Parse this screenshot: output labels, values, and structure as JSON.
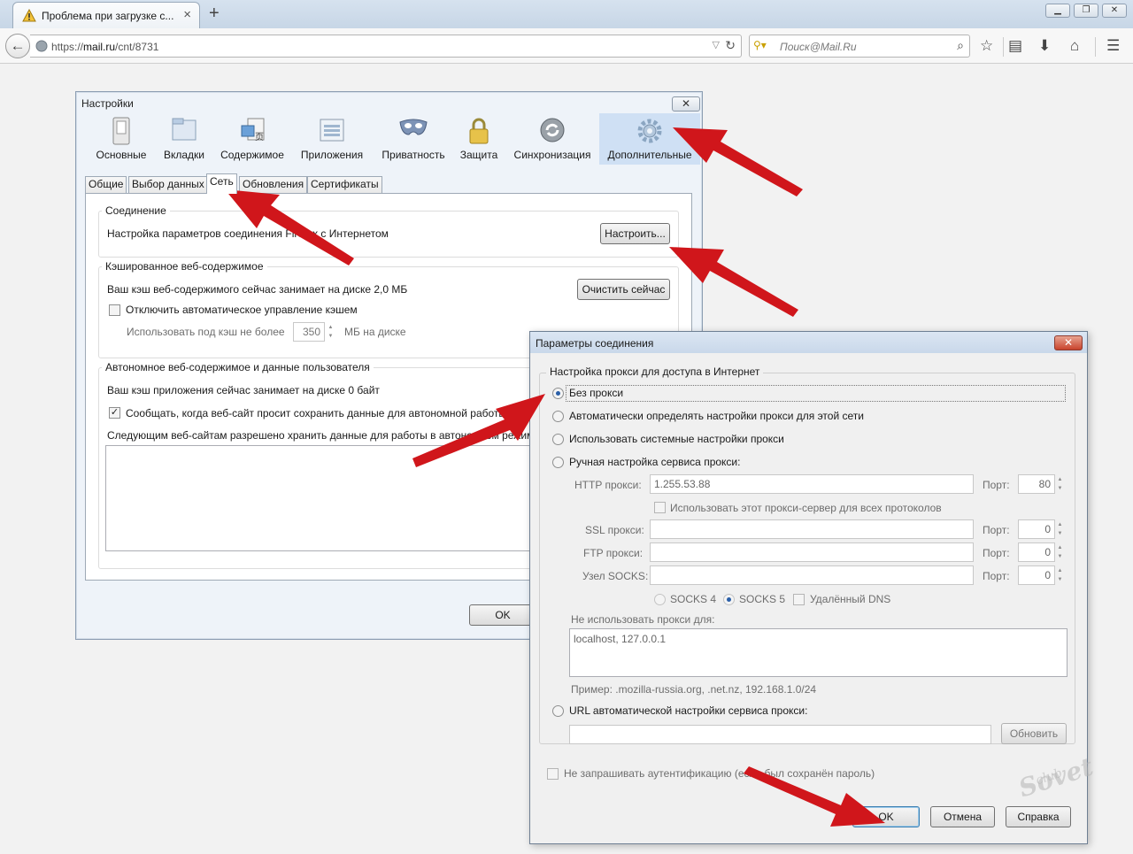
{
  "browser": {
    "tab_title": "Проблема при загрузке с...",
    "url_prefix": "https://",
    "url_host": "mail.ru",
    "url_path": "/cnt/8731",
    "search_placeholder": "Поиск@Mail.Ru"
  },
  "settings": {
    "title": "Настройки",
    "toolbar": [
      {
        "label": "Основные"
      },
      {
        "label": "Вкладки"
      },
      {
        "label": "Содержимое"
      },
      {
        "label": "Приложения"
      },
      {
        "label": "Приватность"
      },
      {
        "label": "Защита"
      },
      {
        "label": "Синхронизация"
      },
      {
        "label": "Дополнительные",
        "active": true
      }
    ],
    "subtabs": [
      "Общие",
      "Выбор данных",
      "Сеть",
      "Обновления",
      "Сертификаты"
    ],
    "active_subtab": "Сеть",
    "connection": {
      "legend": "Соединение",
      "text": "Настройка параметров соединения Firefox с Интернетом",
      "button": "Настроить..."
    },
    "cache": {
      "legend": "Кэшированное веб-содержимое",
      "text": "Ваш кэш веб-содержимого сейчас занимает на диске 2,0 МБ",
      "clear_button": "Очистить сейчас",
      "override_label": "Отключить автоматическое управление кэшем",
      "limit_label": "Использовать под кэш не более",
      "limit_value": "350",
      "limit_unit": "МБ на диске"
    },
    "offline": {
      "legend": "Автономное веб-содержимое и данные пользователя",
      "text": "Ваш кэш приложения сейчас занимает на диске 0 байт",
      "notify_label": "Сообщать, когда веб-сайт просит сохранить данные для автономной работы",
      "allowed_label": "Следующим веб-сайтам разрешено хранить данные для работы в автономном режиме:"
    },
    "ok_button": "OK"
  },
  "connection_dialog": {
    "title": "Параметры соединения",
    "close_icon_label": "✕",
    "legend": "Настройка прокси для доступа в Интернет",
    "options": {
      "no_proxy": "Без прокси",
      "auto_detect": "Автоматически определять настройки прокси для этой сети",
      "system": "Использовать системные настройки прокси",
      "manual": "Ручная настройка сервиса прокси:"
    },
    "http_label": "HTTP прокси:",
    "http_value": "1.255.53.88",
    "port_label": "Порт:",
    "http_port": "80",
    "share_label": "Использовать этот прокси-сервер для всех протоколов",
    "ssl_label": "SSL прокси:",
    "ssl_port": "0",
    "ftp_label": "FTP прокси:",
    "ftp_port": "0",
    "socks_label": "Узел SOCKS:",
    "socks_port": "0",
    "socks4": "SOCKS 4",
    "socks5": "SOCKS 5",
    "remote_dns": "Удалённый DNS",
    "no_proxy_for_label": "Не использовать прокси для:",
    "no_proxy_for_value": "localhost, 127.0.0.1",
    "example": "Пример: .mozilla-russia.org, .net.nz, 192.168.1.0/24",
    "autoconfig_label": "URL автоматической настройки сервиса прокси:",
    "reload_button": "Обновить",
    "no_auth_label": "Не запрашивать аутентификацию (если был сохранён пароль)",
    "ok_button": "OK",
    "cancel_button": "Отмена",
    "help_button": "Справка"
  },
  "watermark": "club Sovet",
  "colors": {
    "arrow": "#d0161b",
    "active_tool_bg": "#cfe0f4",
    "title_bar": "#c9d8ea"
  }
}
